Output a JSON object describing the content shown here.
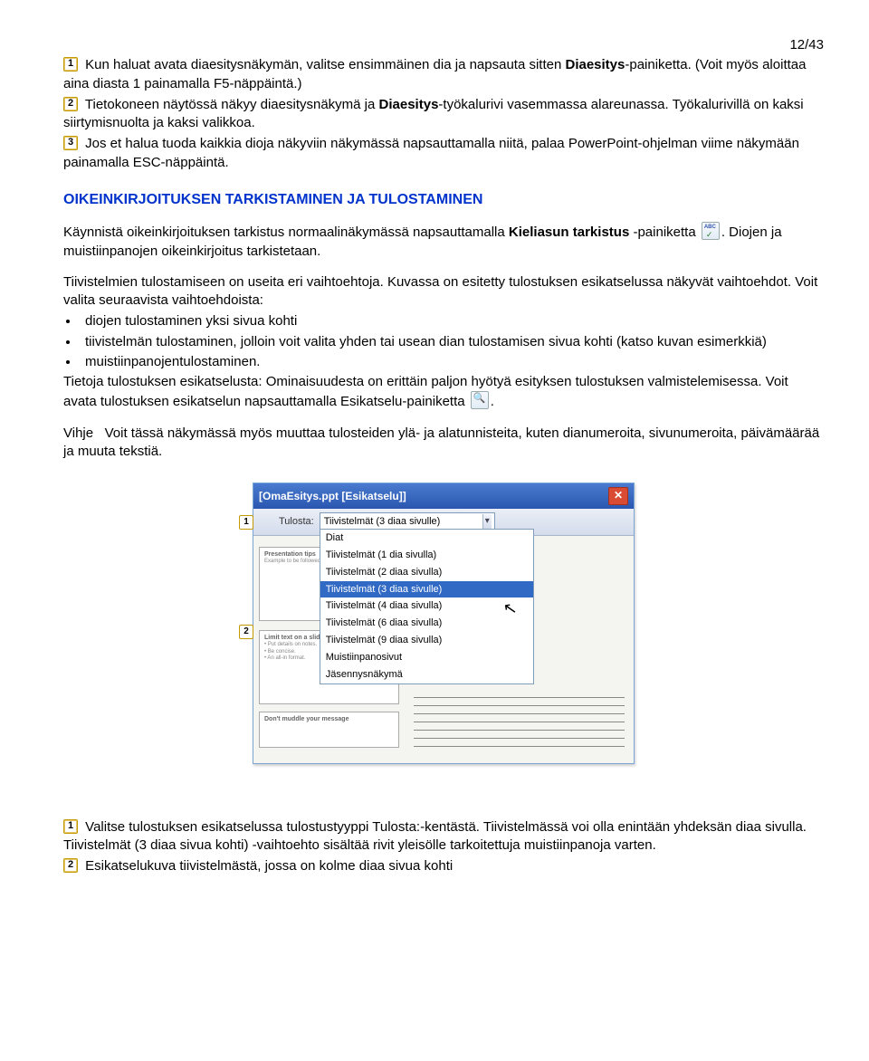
{
  "page_number": "12/43",
  "step1": {
    "num": "1",
    "text_a": "Kun haluat avata diaesitysnäkymän, valitse ensimmäinen dia ja napsauta sitten ",
    "bold_a": "Diaesitys",
    "text_b": "-painiketta. (Voit myös aloittaa aina diasta 1 painamalla F5-näppäintä.)"
  },
  "step2": {
    "num": "2",
    "text_a": "Tietokoneen näytössä näkyy diaesitysnäkymä ja ",
    "bold_a": "Diaesitys",
    "text_b": "-työkalurivi vasemmassa alareunassa. Työkalurivillä on kaksi siirtymisnuolta ja kaksi valikkoa."
  },
  "step3": {
    "num": "3",
    "text": "Jos et halua tuoda kaikkia dioja näkyviin näkymässä napsauttamalla niitä, palaa PowerPoint-ohjelman viime näkymään painamalla ESC-näppäintä."
  },
  "heading": "OIKEINKIRJOITUKSEN TARKISTAMINEN JA TULOSTAMINEN",
  "para1": {
    "a": "Käynnistä oikeinkirjoituksen tarkistus normaalinäkymässä napsauttamalla ",
    "bold": "Kieliasun tarkistus",
    "b": " -painiketta ",
    "c": ". Diojen ja muistiinpanojen oikeinkirjoitus tarkistetaan."
  },
  "para2": "Tiivistelmien tulostamiseen on useita eri vaihtoehtoja. Kuvassa on esitetty tulostuksen esikatselussa näkyvät vaihtoehdot. Voit valita seuraavista vaihtoehdoista:",
  "bullets": [
    "diojen tulostaminen yksi sivua kohti",
    "tiivistelmän tulostaminen, jolloin voit valita yhden tai usean dian tulostamisen sivua kohti (katso kuvan esimerkkiä)",
    "muistiinpanojentulostaminen."
  ],
  "para3": {
    "a": "Tietoja tulostuksen esikatselusta: Ominaisuudesta on erittäin paljon hyötyä esityksen tulostuksen valmistelemisessa. Voit avata tulostuksen esikatselun napsauttamalla Esikatselu-painiketta ",
    "b": "."
  },
  "hint_label": "Vihje",
  "hint_text": "Voit tässä näkymässä myös muuttaa tulosteiden ylä- ja alatunnisteita, kuten dianumeroita, sivunumeroita, päivämäärää ja muuta tekstiä.",
  "screenshot": {
    "title": "[OmaEsitys.ppt [Esikatselu]]",
    "field_label": "Tulosta:",
    "selected": "Tiivistelmät (3 diaa sivulle)",
    "options": [
      "Diat",
      "Tiivistelmät (1 dia sivulla)",
      "Tiivistelmät (2 diaa sivulla)",
      "Tiivistelmät (3 diaa sivulle)",
      "Tiivistelmät (4 diaa sivulla)",
      "Tiivistelmät (6 diaa sivulla)",
      "Tiivistelmät (9 diaa sivulla)",
      "Muistiinpanosivut",
      "Jäsennysnäkymä"
    ],
    "marker1": "1",
    "marker2": "2",
    "thumb1_title": "Presentation tips",
    "thumb1_sub": "Example to be followed",
    "thumb2_title": "Limit text on a slide",
    "thumb2_li1": "• Put details on notes.",
    "thumb2_li2": "• Be concise.",
    "thumb2_li3": "• An all-in format.",
    "thumb3_title": "Don't muddle your message"
  },
  "footnote1": {
    "num": "1",
    "text": "Valitse tulostuksen esikatselussa tulostustyyppi Tulosta:-kentästä. Tiivistelmässä voi olla enintään yhdeksän diaa sivulla. Tiivistelmät (3 diaa sivua kohti) -vaihtoehto sisältää rivit yleisölle tarkoitettuja muistiinpanoja varten."
  },
  "footnote2": {
    "num": "2",
    "text": "Esikatselukuva tiivistelmästä, jossa on kolme diaa sivua kohti"
  }
}
